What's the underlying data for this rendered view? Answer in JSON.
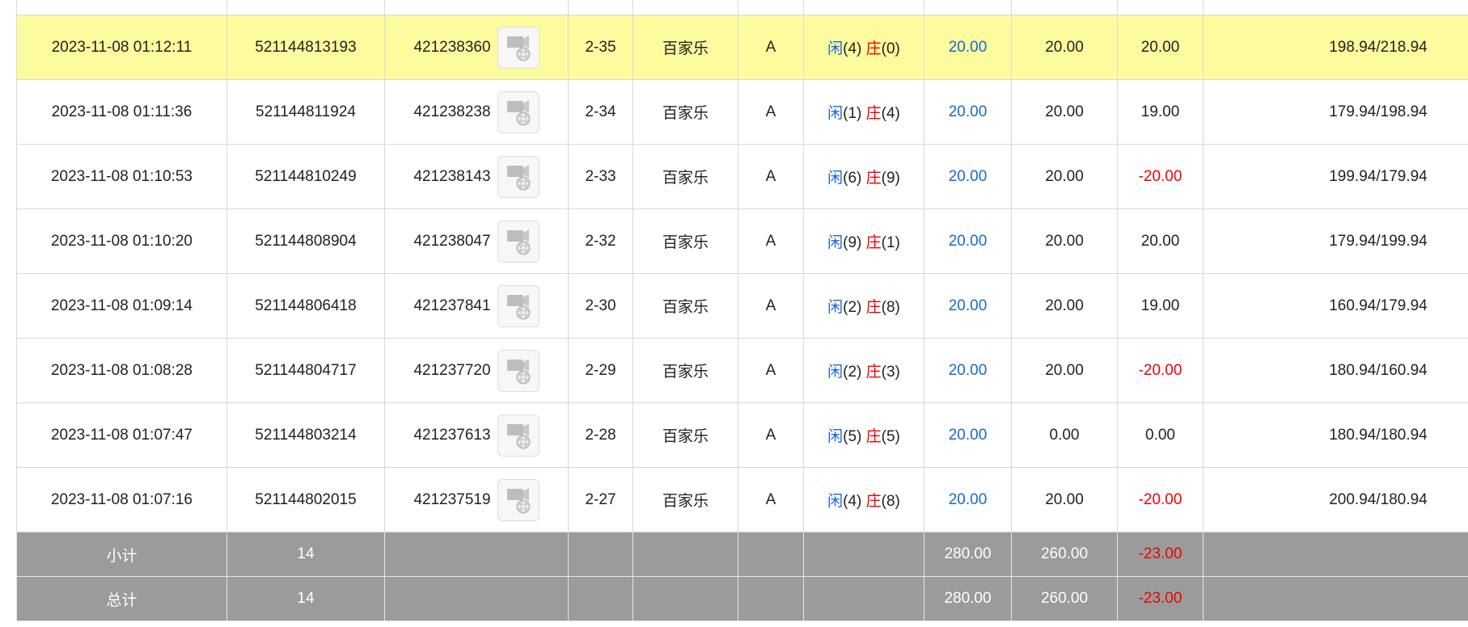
{
  "rows": [
    {
      "time": "2023-11-08 01:12:11",
      "order_id": "521144813193",
      "round_id": "421238360",
      "table": "2-35",
      "game": "百家乐",
      "seat": "A",
      "player_label": "闲",
      "player_score": "(4)",
      "banker_label": "庄",
      "banker_score": "(0)",
      "bet": "20.00",
      "valid_bet": "20.00",
      "win_loss": "20.00",
      "win_negative": false,
      "balance": "198.94/218.94",
      "highlight": true
    },
    {
      "time": "2023-11-08 01:11:36",
      "order_id": "521144811924",
      "round_id": "421238238",
      "table": "2-34",
      "game": "百家乐",
      "seat": "A",
      "player_label": "闲",
      "player_score": "(1)",
      "banker_label": "庄",
      "banker_score": "(4)",
      "bet": "20.00",
      "valid_bet": "20.00",
      "win_loss": "19.00",
      "win_negative": false,
      "balance": "179.94/198.94",
      "highlight": false
    },
    {
      "time": "2023-11-08 01:10:53",
      "order_id": "521144810249",
      "round_id": "421238143",
      "table": "2-33",
      "game": "百家乐",
      "seat": "A",
      "player_label": "闲",
      "player_score": "(6)",
      "banker_label": "庄",
      "banker_score": "(9)",
      "bet": "20.00",
      "valid_bet": "20.00",
      "win_loss": "-20.00",
      "win_negative": true,
      "balance": "199.94/179.94",
      "highlight": false
    },
    {
      "time": "2023-11-08 01:10:20",
      "order_id": "521144808904",
      "round_id": "421238047",
      "table": "2-32",
      "game": "百家乐",
      "seat": "A",
      "player_label": "闲",
      "player_score": "(9)",
      "banker_label": "庄",
      "banker_score": "(1)",
      "bet": "20.00",
      "valid_bet": "20.00",
      "win_loss": "20.00",
      "win_negative": false,
      "balance": "179.94/199.94",
      "highlight": false
    },
    {
      "time": "2023-11-08 01:09:14",
      "order_id": "521144806418",
      "round_id": "421237841",
      "table": "2-30",
      "game": "百家乐",
      "seat": "A",
      "player_label": "闲",
      "player_score": "(2)",
      "banker_label": "庄",
      "banker_score": "(8)",
      "bet": "20.00",
      "valid_bet": "20.00",
      "win_loss": "19.00",
      "win_negative": false,
      "balance": "160.94/179.94",
      "highlight": false
    },
    {
      "time": "2023-11-08 01:08:28",
      "order_id": "521144804717",
      "round_id": "421237720",
      "table": "2-29",
      "game": "百家乐",
      "seat": "A",
      "player_label": "闲",
      "player_score": "(2)",
      "banker_label": "庄",
      "banker_score": "(3)",
      "bet": "20.00",
      "valid_bet": "20.00",
      "win_loss": "-20.00",
      "win_negative": true,
      "balance": "180.94/160.94",
      "highlight": false
    },
    {
      "time": "2023-11-08 01:07:47",
      "order_id": "521144803214",
      "round_id": "421237613",
      "table": "2-28",
      "game": "百家乐",
      "seat": "A",
      "player_label": "闲",
      "player_score": "(5)",
      "banker_label": "庄",
      "banker_score": "(5)",
      "bet": "20.00",
      "valid_bet": "0.00",
      "win_loss": "0.00",
      "win_negative": false,
      "balance": "180.94/180.94",
      "highlight": false
    },
    {
      "time": "2023-11-08 01:07:16",
      "order_id": "521144802015",
      "round_id": "421237519",
      "table": "2-27",
      "game": "百家乐",
      "seat": "A",
      "player_label": "闲",
      "player_score": "(4)",
      "banker_label": "庄",
      "banker_score": "(8)",
      "bet": "20.00",
      "valid_bet": "20.00",
      "win_loss": "-20.00",
      "win_negative": true,
      "balance": "200.94/180.94",
      "highlight": false
    }
  ],
  "summary": {
    "subtotal": {
      "label": "小计",
      "count": "14",
      "bet": "280.00",
      "valid_bet": "260.00",
      "win_loss": "-23.00"
    },
    "total": {
      "label": "总计",
      "count": "14",
      "bet": "280.00",
      "valid_bet": "260.00",
      "win_loss": "-23.00"
    }
  },
  "icons": {
    "replay": "video-replay-icon"
  },
  "colors": {
    "highlight_row": "#fcfc9e",
    "player_blue": "#1a66d6",
    "banker_red": "#ee0000",
    "summary_bg": "#9b9b9b"
  }
}
